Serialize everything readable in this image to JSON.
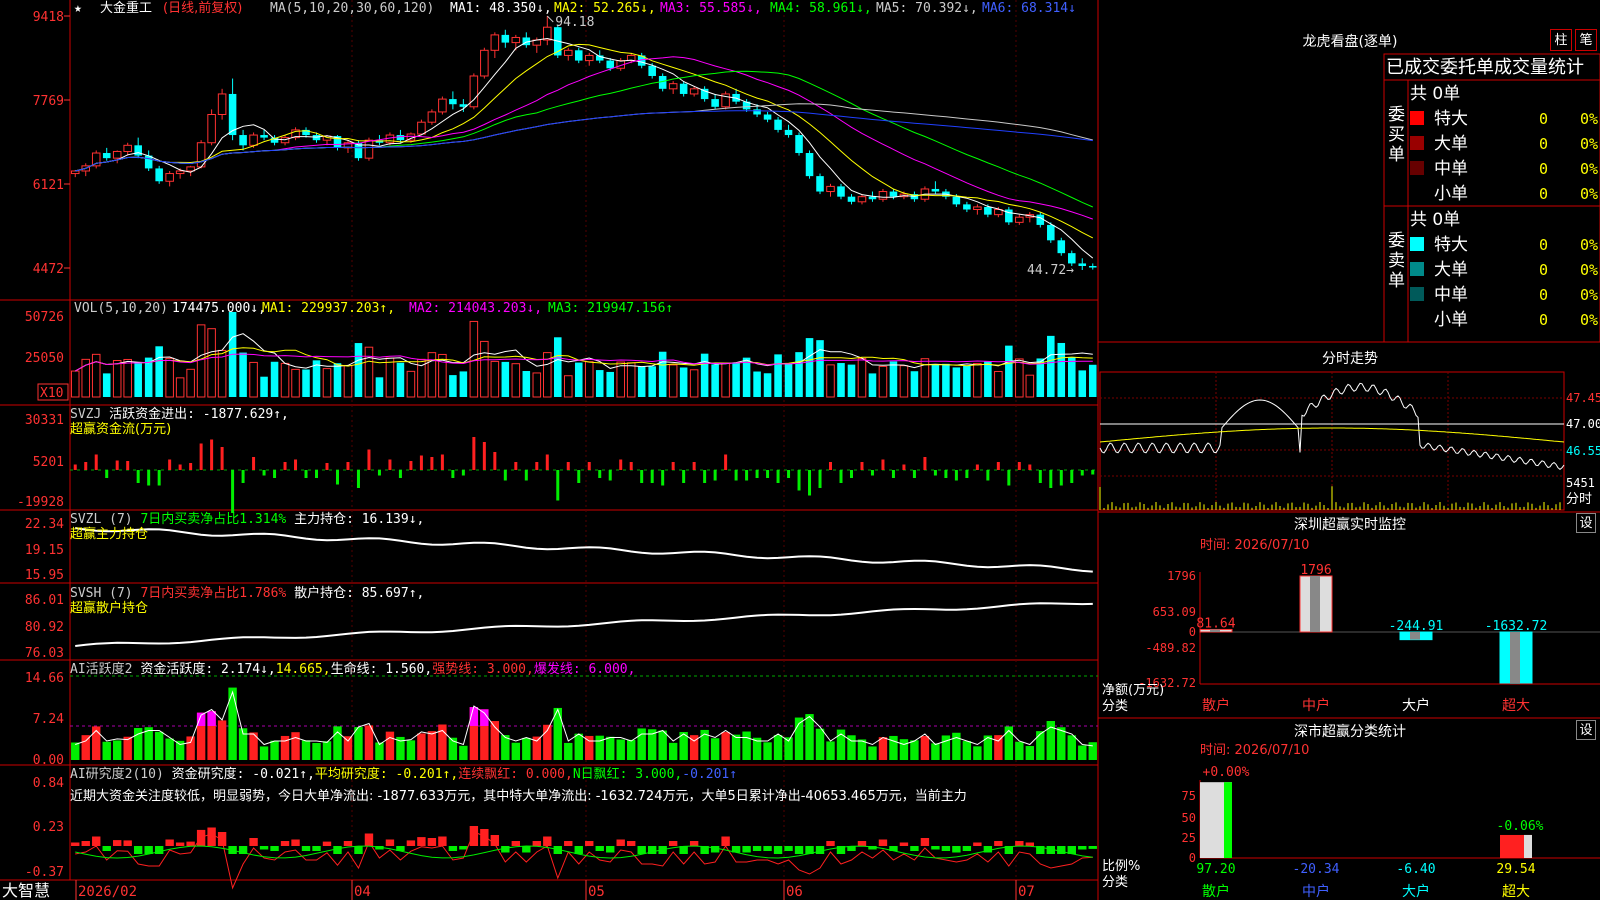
{
  "header": {
    "stock_name": "大金重工",
    "period": "(日线,前复权)",
    "ma_label": "MA(5,10,20,30,60,120)",
    "ma_values": [
      {
        "text": "MA1: 48.350↓,",
        "color": "#ffffff"
      },
      {
        "text": "MA2: 52.265↓,",
        "color": "#ffff00"
      },
      {
        "text": "MA3: 55.585↓,",
        "color": "#ff00ff"
      },
      {
        "text": "MA4: 58.961↓,",
        "color": "#00ff00"
      },
      {
        "text": "MA5: 70.392↓,",
        "color": "#cccccc"
      },
      {
        "text": "MA6: 68.314↓",
        "color": "#4060ff"
      }
    ],
    "high_label": "94.18",
    "low_label": "44.72→"
  },
  "vol_header": {
    "label": "VOL(5,10,20)",
    "value": "174475.000↓,",
    "ma1": "MA1: 229937.203↑,",
    "ma2": "MA2: 214043.203↓,",
    "ma3": "MA3: 219947.156↑"
  },
  "svzj_header": {
    "label": "SVZJ",
    "text": "活跃资金进出: -1877.629↑,",
    "sub": "超赢资金流(万元)"
  },
  "svzl_header": {
    "label": "SVZL (7)",
    "text": "7日内买卖净占比1.314%",
    "text2": "主力持仓: 16.139↓,",
    "sub": "超赢主力持仓"
  },
  "svsh_header": {
    "label": "SVSH (7)",
    "text": "7日内买卖净占比1.786%",
    "text2": "散户持仓: 85.697↑,",
    "sub": "超赢散户持仓"
  },
  "ai1_header": {
    "label": "AI活跃度2",
    "text": "资金活跃度: 2.174↓,",
    "v2": "14.665,",
    "v3": "生命线: 1.560,",
    "v4": "强势线: 3.000,",
    "v5": "爆发线: 6.000,"
  },
  "ai2_header": {
    "label": "AI研究度2(10)",
    "text": "资金研究度: -0.021↑,",
    "v2": "平均研究度: -0.201↑,",
    "v3": "连续飘红: 0.000,",
    "v4": "N日飘红: 3.000,",
    "v5": "-0.201↑"
  },
  "ai2_comment": "近期大资金关注度较低，明显弱势，今日大单净流出: -1877.633万元，其中特大单净流出: -1632.724万元，大单5日累计净出-40653.465万元，当前主力",
  "yaxis": {
    "price": [
      "9418",
      "7769",
      "6121",
      "4472"
    ],
    "vol": [
      "50726",
      "25050",
      "X10"
    ],
    "svzj": [
      "30331",
      "5201",
      "-19928"
    ],
    "svzl": [
      "22.34",
      "19.15",
      "15.95"
    ],
    "svsh": [
      "86.01",
      "80.92",
      "76.03"
    ],
    "ai1": [
      "14.66",
      "7.24",
      "0.00"
    ],
    "ai2": [
      "0.84",
      "0.23",
      "-0.37"
    ]
  },
  "xaxis": {
    "brand": "大智慧",
    "labels": [
      "2026/02",
      "04",
      "05",
      "06",
      "07"
    ]
  },
  "right": {
    "title": "龙虎看盘(逐单)",
    "btn1": "柱",
    "btn2": "笔",
    "stats_title": "已成交委托单成交量统计",
    "buy_side": "委买单",
    "sell_side": "委卖单",
    "total": "共 0单",
    "rows": [
      "特大",
      "大单",
      "中单",
      "小单"
    ],
    "zero": "0",
    "pct": "0%",
    "buy_colors": [
      "#ff0000",
      "#990000",
      "#660000",
      "#000000"
    ],
    "sell_colors": [
      "#00ffff",
      "#008a8a",
      "#005a5a",
      "#000000"
    ],
    "fs_title": "分时走势",
    "fs_prices": [
      "47.45",
      "47.00",
      "46.55"
    ],
    "fs_vol": "5451",
    "fs_label": "分时",
    "mon_title": "深圳超赢实时监控",
    "mon_time": "时间: 2026/07/10",
    "mon_yaxis": [
      "1796",
      "653.09",
      "0",
      "-489.82",
      "-1632.72"
    ],
    "mon_vals": [
      "81.64",
      "1796",
      "-244.91",
      "-1632.72"
    ],
    "mon_ylabel": "净额(万元)",
    "cat_label": "分类",
    "cats": [
      "散户",
      "中户",
      "大户",
      "超大"
    ],
    "stat_title": "深市超赢分类统计",
    "stat_time": "时间: 2026/07/10",
    "stat_yaxis": [
      "75",
      "50",
      "25",
      "0"
    ],
    "stat_top": [
      "+0.00%",
      "-0.06%"
    ],
    "stat_vals": [
      "97.20",
      "-20.34",
      "-6.40",
      "29.54"
    ],
    "stat_ylabel": "比例%",
    "set_btn": "设"
  },
  "chart_data": {
    "type": "candlestick",
    "high": 94.18,
    "low": 44.72,
    "ylim": [
      44.72,
      94.18
    ],
    "xlabels": [
      "2026/02",
      "04",
      "05",
      "06",
      "07"
    ],
    "candles": [
      [
        63.5,
        64.2,
        62.8,
        64.0
      ],
      [
        64.0,
        65.5,
        63.0,
        65.0
      ],
      [
        65.0,
        68.0,
        64.5,
        67.5
      ],
      [
        67.5,
        68.5,
        66.0,
        66.5
      ],
      [
        66.5,
        68.0,
        65.5,
        67.8
      ],
      [
        67.8,
        69.5,
        67.0,
        69.0
      ],
      [
        69.0,
        70.5,
        66.5,
        67.0
      ],
      [
        67.0,
        68.0,
        64.0,
        64.5
      ],
      [
        64.5,
        65.0,
        61.5,
        62.0
      ],
      [
        62.0,
        64.0,
        61.0,
        63.5
      ],
      [
        63.5,
        64.5,
        62.5,
        64.0
      ],
      [
        64.0,
        65.0,
        63.0,
        64.8
      ],
      [
        64.8,
        70.0,
        64.5,
        69.5
      ],
      [
        69.5,
        76.0,
        69.0,
        75.0
      ],
      [
        75.0,
        80.0,
        74.0,
        79.0
      ],
      [
        79.0,
        82.0,
        70.0,
        71.0
      ],
      [
        71.0,
        72.0,
        68.0,
        69.0
      ],
      [
        69.0,
        71.5,
        68.5,
        71.0
      ],
      [
        71.0,
        72.0,
        70.0,
        70.5
      ],
      [
        70.5,
        71.0,
        69.0,
        69.5
      ],
      [
        69.5,
        71.0,
        69.0,
        70.5
      ],
      [
        70.5,
        72.5,
        70.0,
        72.0
      ],
      [
        72.0,
        72.5,
        70.5,
        71.0
      ],
      [
        71.0,
        71.5,
        69.5,
        70.0
      ],
      [
        70.0,
        71.0,
        69.0,
        70.8
      ],
      [
        70.8,
        71.0,
        68.0,
        68.5
      ],
      [
        68.5,
        70.0,
        67.5,
        69.5
      ],
      [
        69.5,
        70.0,
        66.0,
        66.5
      ],
      [
        66.5,
        70.5,
        66.0,
        70.0
      ],
      [
        70.0,
        71.0,
        69.0,
        69.5
      ],
      [
        69.5,
        71.5,
        69.0,
        71.0
      ],
      [
        71.0,
        72.0,
        69.5,
        70.0
      ],
      [
        70.0,
        71.5,
        69.5,
        71.2
      ],
      [
        71.2,
        74.0,
        71.0,
        73.5
      ],
      [
        73.5,
        76.0,
        73.0,
        75.5
      ],
      [
        75.5,
        78.5,
        75.0,
        78.0
      ],
      [
        78.0,
        79.5,
        76.0,
        77.0
      ],
      [
        77.0,
        78.0,
        75.5,
        76.5
      ],
      [
        76.5,
        83.0,
        76.0,
        82.5
      ],
      [
        82.5,
        88.0,
        82.0,
        87.5
      ],
      [
        87.5,
        91.0,
        86.0,
        90.5
      ],
      [
        90.5,
        91.5,
        88.0,
        89.0
      ],
      [
        89.0,
        90.5,
        87.5,
        90.0
      ],
      [
        90.0,
        91.0,
        88.0,
        88.5
      ],
      [
        88.5,
        90.0,
        87.0,
        89.5
      ],
      [
        89.5,
        94.18,
        88.5,
        92.0
      ],
      [
        92.0,
        92.5,
        86.0,
        86.5
      ],
      [
        86.5,
        88.0,
        85.5,
        87.5
      ],
      [
        87.5,
        88.0,
        85.0,
        85.5
      ],
      [
        85.5,
        87.0,
        84.5,
        86.5
      ],
      [
        86.5,
        87.5,
        85.0,
        85.5
      ],
      [
        85.5,
        86.0,
        83.5,
        84.0
      ],
      [
        84.0,
        86.0,
        83.5,
        85.5
      ],
      [
        85.5,
        87.0,
        85.0,
        86.5
      ],
      [
        86.5,
        87.0,
        84.0,
        84.5
      ],
      [
        84.5,
        85.0,
        82.0,
        82.5
      ],
      [
        82.5,
        83.0,
        79.5,
        80.0
      ],
      [
        80.0,
        81.5,
        79.0,
        81.0
      ],
      [
        81.0,
        81.5,
        78.5,
        79.0
      ],
      [
        79.0,
        80.5,
        78.5,
        80.0
      ],
      [
        80.0,
        80.5,
        77.5,
        78.0
      ],
      [
        78.0,
        79.0,
        76.0,
        76.5
      ],
      [
        76.5,
        79.5,
        76.0,
        79.0
      ],
      [
        79.0,
        80.0,
        77.0,
        77.5
      ],
      [
        77.5,
        78.0,
        75.5,
        76.0
      ],
      [
        76.0,
        77.0,
        74.5,
        75.0
      ],
      [
        75.0,
        75.5,
        73.5,
        74.0
      ],
      [
        74.0,
        74.5,
        71.5,
        72.0
      ],
      [
        72.0,
        73.0,
        70.5,
        71.0
      ],
      [
        71.0,
        71.5,
        67.0,
        67.5
      ],
      [
        67.5,
        68.0,
        62.5,
        63.0
      ],
      [
        63.0,
        63.5,
        59.5,
        60.0
      ],
      [
        60.0,
        61.5,
        59.0,
        61.0
      ],
      [
        61.0,
        61.5,
        58.5,
        59.0
      ],
      [
        59.0,
        59.5,
        57.5,
        58.0
      ],
      [
        58.0,
        59.5,
        57.5,
        59.0
      ],
      [
        59.0,
        60.0,
        58.0,
        58.5
      ],
      [
        58.5,
        60.5,
        58.0,
        60.0
      ],
      [
        60.0,
        60.5,
        58.5,
        59.0
      ],
      [
        59.0,
        60.0,
        58.5,
        59.5
      ],
      [
        59.5,
        60.0,
        58.0,
        58.5
      ],
      [
        58.5,
        61.0,
        58.0,
        60.5
      ],
      [
        60.5,
        62.0,
        59.5,
        60.0
      ],
      [
        60.0,
        60.5,
        58.5,
        59.0
      ],
      [
        59.0,
        59.5,
        57.0,
        57.5
      ],
      [
        57.5,
        58.0,
        56.0,
        56.5
      ],
      [
        56.5,
        57.5,
        55.5,
        57.0
      ],
      [
        57.0,
        57.5,
        55.0,
        55.5
      ],
      [
        55.5,
        57.0,
        55.0,
        56.5
      ],
      [
        56.5,
        57.0,
        53.5,
        54.0
      ],
      [
        54.0,
        55.5,
        53.5,
        55.0
      ],
      [
        55.0,
        56.0,
        54.0,
        55.5
      ],
      [
        55.5,
        56.0,
        53.0,
        53.5
      ],
      [
        53.5,
        54.0,
        50.0,
        50.5
      ],
      [
        50.5,
        51.0,
        47.5,
        48.0
      ],
      [
        48.0,
        48.5,
        45.5,
        46.0
      ],
      [
        46.0,
        47.0,
        44.72,
        45.5
      ],
      [
        45.5,
        46.0,
        44.8,
        45.2
      ]
    ]
  }
}
